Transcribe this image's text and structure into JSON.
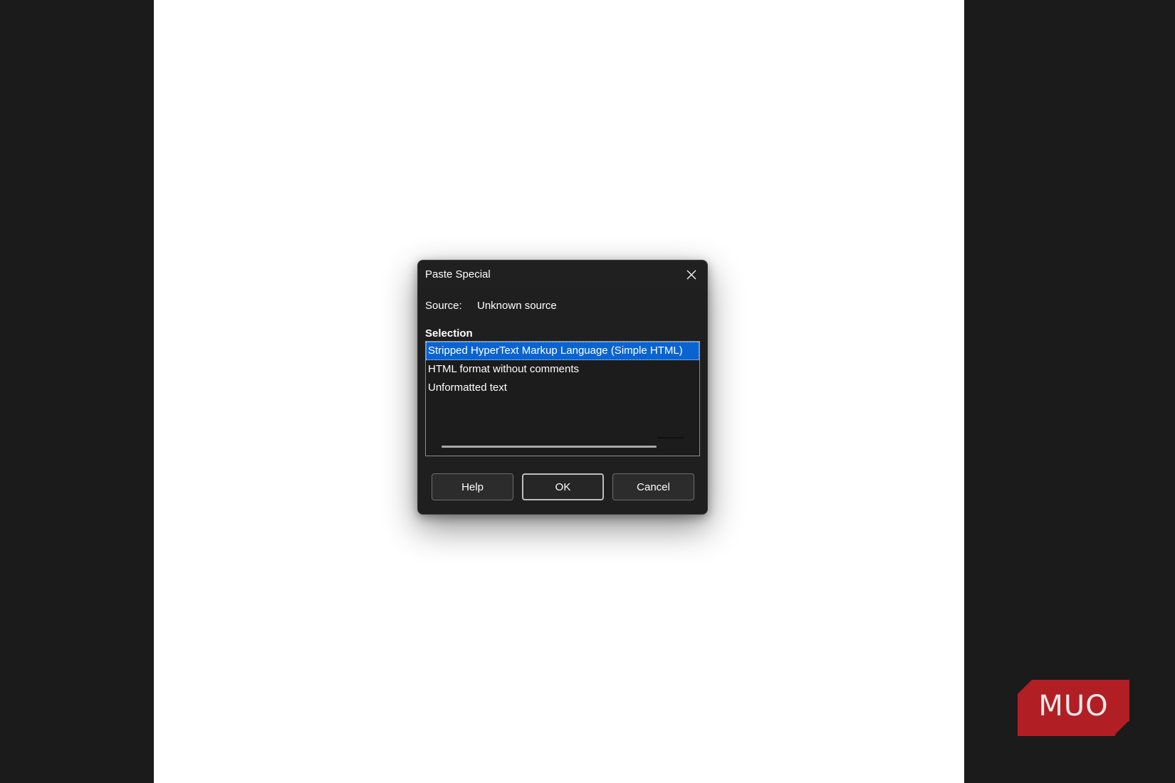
{
  "dialog": {
    "title": "Paste Special",
    "source_label": "Source:",
    "source_value": "Unknown source",
    "selection_heading": "Selection",
    "options": [
      "Stripped HyperText Markup Language (Simple HTML)",
      "HTML format without comments",
      "Unformatted text"
    ],
    "selected_index": 0,
    "buttons": {
      "help": "Help",
      "ok": "OK",
      "cancel": "Cancel"
    }
  },
  "logo": {
    "text": "MUO",
    "color": "#b11f24"
  },
  "icons": {
    "close": "close-icon"
  }
}
